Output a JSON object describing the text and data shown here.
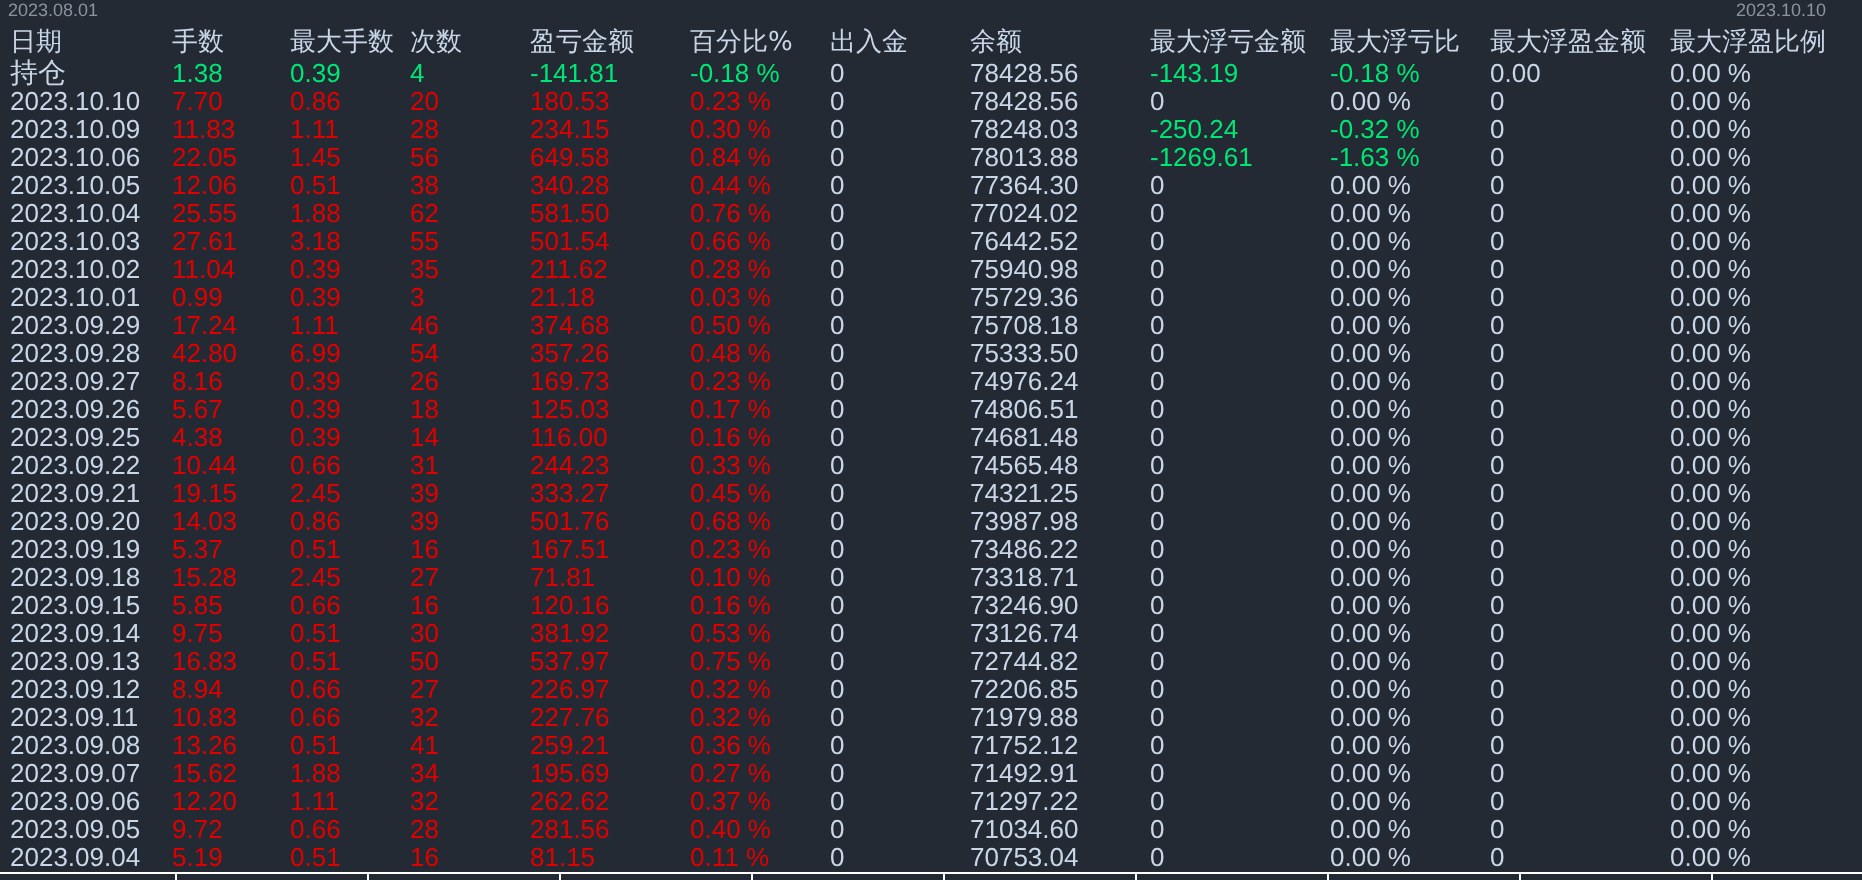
{
  "range": {
    "start": "2023.08.01",
    "end": "2023.10.10"
  },
  "columns": [
    "日期",
    "手数",
    "最大手数",
    "次数",
    "盈亏金额",
    "百分比%",
    "出入金",
    "余额",
    "最大浮亏金额",
    "最大浮亏比",
    "最大浮盈金额",
    "最大浮盈比例"
  ],
  "rows": [
    {
      "cells": [
        {
          "text": "持仓",
          "color": "#c8d6e8"
        },
        {
          "text": "1.38",
          "color": "#00e676"
        },
        {
          "text": "0.39",
          "color": "#00e676"
        },
        {
          "text": "4",
          "color": "#00e676"
        },
        {
          "text": "-141.81",
          "color": "#00e676"
        },
        {
          "text": "-0.18 %",
          "color": "#00e676"
        },
        {
          "text": "0",
          "color": "#c8d6e8"
        },
        {
          "text": "78428.56",
          "color": "#c8d6e8"
        },
        {
          "text": "-143.19",
          "color": "#00e676"
        },
        {
          "text": "-0.18 %",
          "color": "#00e676"
        },
        {
          "text": "0.00",
          "color": "#c8d6e8"
        },
        {
          "text": "0.00 %",
          "color": "#c8d6e8"
        }
      ]
    },
    {
      "cells": [
        {
          "text": "2023.10.10",
          "color": "#c8d6e8"
        },
        {
          "text": "7.70",
          "color": "#e00000"
        },
        {
          "text": "0.86",
          "color": "#e00000"
        },
        {
          "text": "20",
          "color": "#e00000"
        },
        {
          "text": "180.53",
          "color": "#e00000"
        },
        {
          "text": "0.23 %",
          "color": "#e00000"
        },
        {
          "text": "0",
          "color": "#c8d6e8"
        },
        {
          "text": "78428.56",
          "color": "#c8d6e8"
        },
        {
          "text": "0",
          "color": "#c8d6e8"
        },
        {
          "text": "0.00 %",
          "color": "#c8d6e8"
        },
        {
          "text": "0",
          "color": "#c8d6e8"
        },
        {
          "text": "0.00 %",
          "color": "#c8d6e8"
        }
      ]
    },
    {
      "cells": [
        {
          "text": "2023.10.09",
          "color": "#c8d6e8"
        },
        {
          "text": "11.83",
          "color": "#e00000"
        },
        {
          "text": "1.11",
          "color": "#e00000"
        },
        {
          "text": "28",
          "color": "#e00000"
        },
        {
          "text": "234.15",
          "color": "#e00000"
        },
        {
          "text": "0.30 %",
          "color": "#e00000"
        },
        {
          "text": "0",
          "color": "#c8d6e8"
        },
        {
          "text": "78248.03",
          "color": "#c8d6e8"
        },
        {
          "text": "-250.24",
          "color": "#00e676"
        },
        {
          "text": "-0.32 %",
          "color": "#00e676"
        },
        {
          "text": "0",
          "color": "#c8d6e8"
        },
        {
          "text": "0.00 %",
          "color": "#c8d6e8"
        }
      ]
    },
    {
      "cells": [
        {
          "text": "2023.10.06",
          "color": "#c8d6e8"
        },
        {
          "text": "22.05",
          "color": "#e00000"
        },
        {
          "text": "1.45",
          "color": "#e00000"
        },
        {
          "text": "56",
          "color": "#e00000"
        },
        {
          "text": "649.58",
          "color": "#e00000"
        },
        {
          "text": "0.84 %",
          "color": "#e00000"
        },
        {
          "text": "0",
          "color": "#c8d6e8"
        },
        {
          "text": "78013.88",
          "color": "#c8d6e8"
        },
        {
          "text": "-1269.61",
          "color": "#00e676"
        },
        {
          "text": "-1.63 %",
          "color": "#00e676"
        },
        {
          "text": "0",
          "color": "#c8d6e8"
        },
        {
          "text": "0.00 %",
          "color": "#c8d6e8"
        }
      ]
    },
    {
      "cells": [
        {
          "text": "2023.10.05",
          "color": "#c8d6e8"
        },
        {
          "text": "12.06",
          "color": "#e00000"
        },
        {
          "text": "0.51",
          "color": "#e00000"
        },
        {
          "text": "38",
          "color": "#e00000"
        },
        {
          "text": "340.28",
          "color": "#e00000"
        },
        {
          "text": "0.44 %",
          "color": "#e00000"
        },
        {
          "text": "0",
          "color": "#c8d6e8"
        },
        {
          "text": "77364.30",
          "color": "#c8d6e8"
        },
        {
          "text": "0",
          "color": "#c8d6e8"
        },
        {
          "text": "0.00 %",
          "color": "#c8d6e8"
        },
        {
          "text": "0",
          "color": "#c8d6e8"
        },
        {
          "text": "0.00 %",
          "color": "#c8d6e8"
        }
      ]
    },
    {
      "cells": [
        {
          "text": "2023.10.04",
          "color": "#c8d6e8"
        },
        {
          "text": "25.55",
          "color": "#e00000"
        },
        {
          "text": "1.88",
          "color": "#e00000"
        },
        {
          "text": "62",
          "color": "#e00000"
        },
        {
          "text": "581.50",
          "color": "#e00000"
        },
        {
          "text": "0.76 %",
          "color": "#e00000"
        },
        {
          "text": "0",
          "color": "#c8d6e8"
        },
        {
          "text": "77024.02",
          "color": "#c8d6e8"
        },
        {
          "text": "0",
          "color": "#c8d6e8"
        },
        {
          "text": "0.00 %",
          "color": "#c8d6e8"
        },
        {
          "text": "0",
          "color": "#c8d6e8"
        },
        {
          "text": "0.00 %",
          "color": "#c8d6e8"
        }
      ]
    },
    {
      "cells": [
        {
          "text": "2023.10.03",
          "color": "#c8d6e8"
        },
        {
          "text": "27.61",
          "color": "#e00000"
        },
        {
          "text": "3.18",
          "color": "#e00000"
        },
        {
          "text": "55",
          "color": "#e00000"
        },
        {
          "text": "501.54",
          "color": "#e00000"
        },
        {
          "text": "0.66 %",
          "color": "#e00000"
        },
        {
          "text": "0",
          "color": "#c8d6e8"
        },
        {
          "text": "76442.52",
          "color": "#c8d6e8"
        },
        {
          "text": "0",
          "color": "#c8d6e8"
        },
        {
          "text": "0.00 %",
          "color": "#c8d6e8"
        },
        {
          "text": "0",
          "color": "#c8d6e8"
        },
        {
          "text": "0.00 %",
          "color": "#c8d6e8"
        }
      ]
    },
    {
      "cells": [
        {
          "text": "2023.10.02",
          "color": "#c8d6e8"
        },
        {
          "text": "11.04",
          "color": "#e00000"
        },
        {
          "text": "0.39",
          "color": "#e00000"
        },
        {
          "text": "35",
          "color": "#e00000"
        },
        {
          "text": "211.62",
          "color": "#e00000"
        },
        {
          "text": "0.28 %",
          "color": "#e00000"
        },
        {
          "text": "0",
          "color": "#c8d6e8"
        },
        {
          "text": "75940.98",
          "color": "#c8d6e8"
        },
        {
          "text": "0",
          "color": "#c8d6e8"
        },
        {
          "text": "0.00 %",
          "color": "#c8d6e8"
        },
        {
          "text": "0",
          "color": "#c8d6e8"
        },
        {
          "text": "0.00 %",
          "color": "#c8d6e8"
        }
      ]
    },
    {
      "cells": [
        {
          "text": "2023.10.01",
          "color": "#c8d6e8"
        },
        {
          "text": "0.99",
          "color": "#e00000"
        },
        {
          "text": "0.39",
          "color": "#e00000"
        },
        {
          "text": "3",
          "color": "#e00000"
        },
        {
          "text": "21.18",
          "color": "#e00000"
        },
        {
          "text": "0.03 %",
          "color": "#e00000"
        },
        {
          "text": "0",
          "color": "#c8d6e8"
        },
        {
          "text": "75729.36",
          "color": "#c8d6e8"
        },
        {
          "text": "0",
          "color": "#c8d6e8"
        },
        {
          "text": "0.00 %",
          "color": "#c8d6e8"
        },
        {
          "text": "0",
          "color": "#c8d6e8"
        },
        {
          "text": "0.00 %",
          "color": "#c8d6e8"
        }
      ]
    },
    {
      "cells": [
        {
          "text": "2023.09.29",
          "color": "#c8d6e8"
        },
        {
          "text": "17.24",
          "color": "#e00000"
        },
        {
          "text": "1.11",
          "color": "#e00000"
        },
        {
          "text": "46",
          "color": "#e00000"
        },
        {
          "text": "374.68",
          "color": "#e00000"
        },
        {
          "text": "0.50 %",
          "color": "#e00000"
        },
        {
          "text": "0",
          "color": "#c8d6e8"
        },
        {
          "text": "75708.18",
          "color": "#c8d6e8"
        },
        {
          "text": "0",
          "color": "#c8d6e8"
        },
        {
          "text": "0.00 %",
          "color": "#c8d6e8"
        },
        {
          "text": "0",
          "color": "#c8d6e8"
        },
        {
          "text": "0.00 %",
          "color": "#c8d6e8"
        }
      ]
    },
    {
      "cells": [
        {
          "text": "2023.09.28",
          "color": "#c8d6e8"
        },
        {
          "text": "42.80",
          "color": "#e00000"
        },
        {
          "text": "6.99",
          "color": "#e00000"
        },
        {
          "text": "54",
          "color": "#e00000"
        },
        {
          "text": "357.26",
          "color": "#e00000"
        },
        {
          "text": "0.48 %",
          "color": "#e00000"
        },
        {
          "text": "0",
          "color": "#c8d6e8"
        },
        {
          "text": "75333.50",
          "color": "#c8d6e8"
        },
        {
          "text": "0",
          "color": "#c8d6e8"
        },
        {
          "text": "0.00 %",
          "color": "#c8d6e8"
        },
        {
          "text": "0",
          "color": "#c8d6e8"
        },
        {
          "text": "0.00 %",
          "color": "#c8d6e8"
        }
      ]
    },
    {
      "cells": [
        {
          "text": "2023.09.27",
          "color": "#c8d6e8"
        },
        {
          "text": "8.16",
          "color": "#e00000"
        },
        {
          "text": "0.39",
          "color": "#e00000"
        },
        {
          "text": "26",
          "color": "#e00000"
        },
        {
          "text": "169.73",
          "color": "#e00000"
        },
        {
          "text": "0.23 %",
          "color": "#e00000"
        },
        {
          "text": "0",
          "color": "#c8d6e8"
        },
        {
          "text": "74976.24",
          "color": "#c8d6e8"
        },
        {
          "text": "0",
          "color": "#c8d6e8"
        },
        {
          "text": "0.00 %",
          "color": "#c8d6e8"
        },
        {
          "text": "0",
          "color": "#c8d6e8"
        },
        {
          "text": "0.00 %",
          "color": "#c8d6e8"
        }
      ]
    },
    {
      "cells": [
        {
          "text": "2023.09.26",
          "color": "#c8d6e8"
        },
        {
          "text": "5.67",
          "color": "#e00000"
        },
        {
          "text": "0.39",
          "color": "#e00000"
        },
        {
          "text": "18",
          "color": "#e00000"
        },
        {
          "text": "125.03",
          "color": "#e00000"
        },
        {
          "text": "0.17 %",
          "color": "#e00000"
        },
        {
          "text": "0",
          "color": "#c8d6e8"
        },
        {
          "text": "74806.51",
          "color": "#c8d6e8"
        },
        {
          "text": "0",
          "color": "#c8d6e8"
        },
        {
          "text": "0.00 %",
          "color": "#c8d6e8"
        },
        {
          "text": "0",
          "color": "#c8d6e8"
        },
        {
          "text": "0.00 %",
          "color": "#c8d6e8"
        }
      ]
    },
    {
      "cells": [
        {
          "text": "2023.09.25",
          "color": "#c8d6e8"
        },
        {
          "text": "4.38",
          "color": "#e00000"
        },
        {
          "text": "0.39",
          "color": "#e00000"
        },
        {
          "text": "14",
          "color": "#e00000"
        },
        {
          "text": "116.00",
          "color": "#e00000"
        },
        {
          "text": "0.16 %",
          "color": "#e00000"
        },
        {
          "text": "0",
          "color": "#c8d6e8"
        },
        {
          "text": "74681.48",
          "color": "#c8d6e8"
        },
        {
          "text": "0",
          "color": "#c8d6e8"
        },
        {
          "text": "0.00 %",
          "color": "#c8d6e8"
        },
        {
          "text": "0",
          "color": "#c8d6e8"
        },
        {
          "text": "0.00 %",
          "color": "#c8d6e8"
        }
      ]
    },
    {
      "cells": [
        {
          "text": "2023.09.22",
          "color": "#c8d6e8"
        },
        {
          "text": "10.44",
          "color": "#e00000"
        },
        {
          "text": "0.66",
          "color": "#e00000"
        },
        {
          "text": "31",
          "color": "#e00000"
        },
        {
          "text": "244.23",
          "color": "#e00000"
        },
        {
          "text": "0.33 %",
          "color": "#e00000"
        },
        {
          "text": "0",
          "color": "#c8d6e8"
        },
        {
          "text": "74565.48",
          "color": "#c8d6e8"
        },
        {
          "text": "0",
          "color": "#c8d6e8"
        },
        {
          "text": "0.00 %",
          "color": "#c8d6e8"
        },
        {
          "text": "0",
          "color": "#c8d6e8"
        },
        {
          "text": "0.00 %",
          "color": "#c8d6e8"
        }
      ]
    },
    {
      "cells": [
        {
          "text": "2023.09.21",
          "color": "#c8d6e8"
        },
        {
          "text": "19.15",
          "color": "#e00000"
        },
        {
          "text": "2.45",
          "color": "#e00000"
        },
        {
          "text": "39",
          "color": "#e00000"
        },
        {
          "text": "333.27",
          "color": "#e00000"
        },
        {
          "text": "0.45 %",
          "color": "#e00000"
        },
        {
          "text": "0",
          "color": "#c8d6e8"
        },
        {
          "text": "74321.25",
          "color": "#c8d6e8"
        },
        {
          "text": "0",
          "color": "#c8d6e8"
        },
        {
          "text": "0.00 %",
          "color": "#c8d6e8"
        },
        {
          "text": "0",
          "color": "#c8d6e8"
        },
        {
          "text": "0.00 %",
          "color": "#c8d6e8"
        }
      ]
    },
    {
      "cells": [
        {
          "text": "2023.09.20",
          "color": "#c8d6e8"
        },
        {
          "text": "14.03",
          "color": "#e00000"
        },
        {
          "text": "0.86",
          "color": "#e00000"
        },
        {
          "text": "39",
          "color": "#e00000"
        },
        {
          "text": "501.76",
          "color": "#e00000"
        },
        {
          "text": "0.68 %",
          "color": "#e00000"
        },
        {
          "text": "0",
          "color": "#c8d6e8"
        },
        {
          "text": "73987.98",
          "color": "#c8d6e8"
        },
        {
          "text": "0",
          "color": "#c8d6e8"
        },
        {
          "text": "0.00 %",
          "color": "#c8d6e8"
        },
        {
          "text": "0",
          "color": "#c8d6e8"
        },
        {
          "text": "0.00 %",
          "color": "#c8d6e8"
        }
      ]
    },
    {
      "cells": [
        {
          "text": "2023.09.19",
          "color": "#c8d6e8"
        },
        {
          "text": "5.37",
          "color": "#e00000"
        },
        {
          "text": "0.51",
          "color": "#e00000"
        },
        {
          "text": "16",
          "color": "#e00000"
        },
        {
          "text": "167.51",
          "color": "#e00000"
        },
        {
          "text": "0.23 %",
          "color": "#e00000"
        },
        {
          "text": "0",
          "color": "#c8d6e8"
        },
        {
          "text": "73486.22",
          "color": "#c8d6e8"
        },
        {
          "text": "0",
          "color": "#c8d6e8"
        },
        {
          "text": "0.00 %",
          "color": "#c8d6e8"
        },
        {
          "text": "0",
          "color": "#c8d6e8"
        },
        {
          "text": "0.00 %",
          "color": "#c8d6e8"
        }
      ]
    },
    {
      "cells": [
        {
          "text": "2023.09.18",
          "color": "#c8d6e8"
        },
        {
          "text": "15.28",
          "color": "#e00000"
        },
        {
          "text": "2.45",
          "color": "#e00000"
        },
        {
          "text": "27",
          "color": "#e00000"
        },
        {
          "text": "71.81",
          "color": "#e00000"
        },
        {
          "text": "0.10 %",
          "color": "#e00000"
        },
        {
          "text": "0",
          "color": "#c8d6e8"
        },
        {
          "text": "73318.71",
          "color": "#c8d6e8"
        },
        {
          "text": "0",
          "color": "#c8d6e8"
        },
        {
          "text": "0.00 %",
          "color": "#c8d6e8"
        },
        {
          "text": "0",
          "color": "#c8d6e8"
        },
        {
          "text": "0.00 %",
          "color": "#c8d6e8"
        }
      ]
    },
    {
      "cells": [
        {
          "text": "2023.09.15",
          "color": "#c8d6e8"
        },
        {
          "text": "5.85",
          "color": "#e00000"
        },
        {
          "text": "0.66",
          "color": "#e00000"
        },
        {
          "text": "16",
          "color": "#e00000"
        },
        {
          "text": "120.16",
          "color": "#e00000"
        },
        {
          "text": "0.16 %",
          "color": "#e00000"
        },
        {
          "text": "0",
          "color": "#c8d6e8"
        },
        {
          "text": "73246.90",
          "color": "#c8d6e8"
        },
        {
          "text": "0",
          "color": "#c8d6e8"
        },
        {
          "text": "0.00 %",
          "color": "#c8d6e8"
        },
        {
          "text": "0",
          "color": "#c8d6e8"
        },
        {
          "text": "0.00 %",
          "color": "#c8d6e8"
        }
      ]
    },
    {
      "cells": [
        {
          "text": "2023.09.14",
          "color": "#c8d6e8"
        },
        {
          "text": "9.75",
          "color": "#e00000"
        },
        {
          "text": "0.51",
          "color": "#e00000"
        },
        {
          "text": "30",
          "color": "#e00000"
        },
        {
          "text": "381.92",
          "color": "#e00000"
        },
        {
          "text": "0.53 %",
          "color": "#e00000"
        },
        {
          "text": "0",
          "color": "#c8d6e8"
        },
        {
          "text": "73126.74",
          "color": "#c8d6e8"
        },
        {
          "text": "0",
          "color": "#c8d6e8"
        },
        {
          "text": "0.00 %",
          "color": "#c8d6e8"
        },
        {
          "text": "0",
          "color": "#c8d6e8"
        },
        {
          "text": "0.00 %",
          "color": "#c8d6e8"
        }
      ]
    },
    {
      "cells": [
        {
          "text": "2023.09.13",
          "color": "#c8d6e8"
        },
        {
          "text": "16.83",
          "color": "#e00000"
        },
        {
          "text": "0.51",
          "color": "#e00000"
        },
        {
          "text": "50",
          "color": "#e00000"
        },
        {
          "text": "537.97",
          "color": "#e00000"
        },
        {
          "text": "0.75 %",
          "color": "#e00000"
        },
        {
          "text": "0",
          "color": "#c8d6e8"
        },
        {
          "text": "72744.82",
          "color": "#c8d6e8"
        },
        {
          "text": "0",
          "color": "#c8d6e8"
        },
        {
          "text": "0.00 %",
          "color": "#c8d6e8"
        },
        {
          "text": "0",
          "color": "#c8d6e8"
        },
        {
          "text": "0.00 %",
          "color": "#c8d6e8"
        }
      ]
    },
    {
      "cells": [
        {
          "text": "2023.09.12",
          "color": "#c8d6e8"
        },
        {
          "text": "8.94",
          "color": "#e00000"
        },
        {
          "text": "0.66",
          "color": "#e00000"
        },
        {
          "text": "27",
          "color": "#e00000"
        },
        {
          "text": "226.97",
          "color": "#e00000"
        },
        {
          "text": "0.32 %",
          "color": "#e00000"
        },
        {
          "text": "0",
          "color": "#c8d6e8"
        },
        {
          "text": "72206.85",
          "color": "#c8d6e8"
        },
        {
          "text": "0",
          "color": "#c8d6e8"
        },
        {
          "text": "0.00 %",
          "color": "#c8d6e8"
        },
        {
          "text": "0",
          "color": "#c8d6e8"
        },
        {
          "text": "0.00 %",
          "color": "#c8d6e8"
        }
      ]
    },
    {
      "cells": [
        {
          "text": "2023.09.11",
          "color": "#c8d6e8"
        },
        {
          "text": "10.83",
          "color": "#e00000"
        },
        {
          "text": "0.66",
          "color": "#e00000"
        },
        {
          "text": "32",
          "color": "#e00000"
        },
        {
          "text": "227.76",
          "color": "#e00000"
        },
        {
          "text": "0.32 %",
          "color": "#e00000"
        },
        {
          "text": "0",
          "color": "#c8d6e8"
        },
        {
          "text": "71979.88",
          "color": "#c8d6e8"
        },
        {
          "text": "0",
          "color": "#c8d6e8"
        },
        {
          "text": "0.00 %",
          "color": "#c8d6e8"
        },
        {
          "text": "0",
          "color": "#c8d6e8"
        },
        {
          "text": "0.00 %",
          "color": "#c8d6e8"
        }
      ]
    },
    {
      "cells": [
        {
          "text": "2023.09.08",
          "color": "#c8d6e8"
        },
        {
          "text": "13.26",
          "color": "#e00000"
        },
        {
          "text": "0.51",
          "color": "#e00000"
        },
        {
          "text": "41",
          "color": "#e00000"
        },
        {
          "text": "259.21",
          "color": "#e00000"
        },
        {
          "text": "0.36 %",
          "color": "#e00000"
        },
        {
          "text": "0",
          "color": "#c8d6e8"
        },
        {
          "text": "71752.12",
          "color": "#c8d6e8"
        },
        {
          "text": "0",
          "color": "#c8d6e8"
        },
        {
          "text": "0.00 %",
          "color": "#c8d6e8"
        },
        {
          "text": "0",
          "color": "#c8d6e8"
        },
        {
          "text": "0.00 %",
          "color": "#c8d6e8"
        }
      ]
    },
    {
      "cells": [
        {
          "text": "2023.09.07",
          "color": "#c8d6e8"
        },
        {
          "text": "15.62",
          "color": "#e00000"
        },
        {
          "text": "1.88",
          "color": "#e00000"
        },
        {
          "text": "34",
          "color": "#e00000"
        },
        {
          "text": "195.69",
          "color": "#e00000"
        },
        {
          "text": "0.27 %",
          "color": "#e00000"
        },
        {
          "text": "0",
          "color": "#c8d6e8"
        },
        {
          "text": "71492.91",
          "color": "#c8d6e8"
        },
        {
          "text": "0",
          "color": "#c8d6e8"
        },
        {
          "text": "0.00 %",
          "color": "#c8d6e8"
        },
        {
          "text": "0",
          "color": "#c8d6e8"
        },
        {
          "text": "0.00 %",
          "color": "#c8d6e8"
        }
      ]
    },
    {
      "cells": [
        {
          "text": "2023.09.06",
          "color": "#c8d6e8"
        },
        {
          "text": "12.20",
          "color": "#e00000"
        },
        {
          "text": "1.11",
          "color": "#e00000"
        },
        {
          "text": "32",
          "color": "#e00000"
        },
        {
          "text": "262.62",
          "color": "#e00000"
        },
        {
          "text": "0.37 %",
          "color": "#e00000"
        },
        {
          "text": "0",
          "color": "#c8d6e8"
        },
        {
          "text": "71297.22",
          "color": "#c8d6e8"
        },
        {
          "text": "0",
          "color": "#c8d6e8"
        },
        {
          "text": "0.00 %",
          "color": "#c8d6e8"
        },
        {
          "text": "0",
          "color": "#c8d6e8"
        },
        {
          "text": "0.00 %",
          "color": "#c8d6e8"
        }
      ]
    },
    {
      "cells": [
        {
          "text": "2023.09.05",
          "color": "#c8d6e8"
        },
        {
          "text": "9.72",
          "color": "#e00000"
        },
        {
          "text": "0.66",
          "color": "#e00000"
        },
        {
          "text": "28",
          "color": "#e00000"
        },
        {
          "text": "281.56",
          "color": "#e00000"
        },
        {
          "text": "0.40 %",
          "color": "#e00000"
        },
        {
          "text": "0",
          "color": "#c8d6e8"
        },
        {
          "text": "71034.60",
          "color": "#c8d6e8"
        },
        {
          "text": "0",
          "color": "#c8d6e8"
        },
        {
          "text": "0.00 %",
          "color": "#c8d6e8"
        },
        {
          "text": "0",
          "color": "#c8d6e8"
        },
        {
          "text": "0.00 %",
          "color": "#c8d6e8"
        }
      ]
    },
    {
      "cells": [
        {
          "text": "2023.09.04",
          "color": "#c8d6e8"
        },
        {
          "text": "5.19",
          "color": "#e00000"
        },
        {
          "text": "0.51",
          "color": "#e00000"
        },
        {
          "text": "16",
          "color": "#e00000"
        },
        {
          "text": "81.15",
          "color": "#e00000"
        },
        {
          "text": "0.11 %",
          "color": "#e00000"
        },
        {
          "text": "0",
          "color": "#c8d6e8"
        },
        {
          "text": "70753.04",
          "color": "#c8d6e8"
        },
        {
          "text": "0",
          "color": "#c8d6e8"
        },
        {
          "text": "0.00 %",
          "color": "#c8d6e8"
        },
        {
          "text": "0",
          "color": "#c8d6e8"
        },
        {
          "text": "0.00 %",
          "color": "#c8d6e8"
        }
      ]
    }
  ]
}
